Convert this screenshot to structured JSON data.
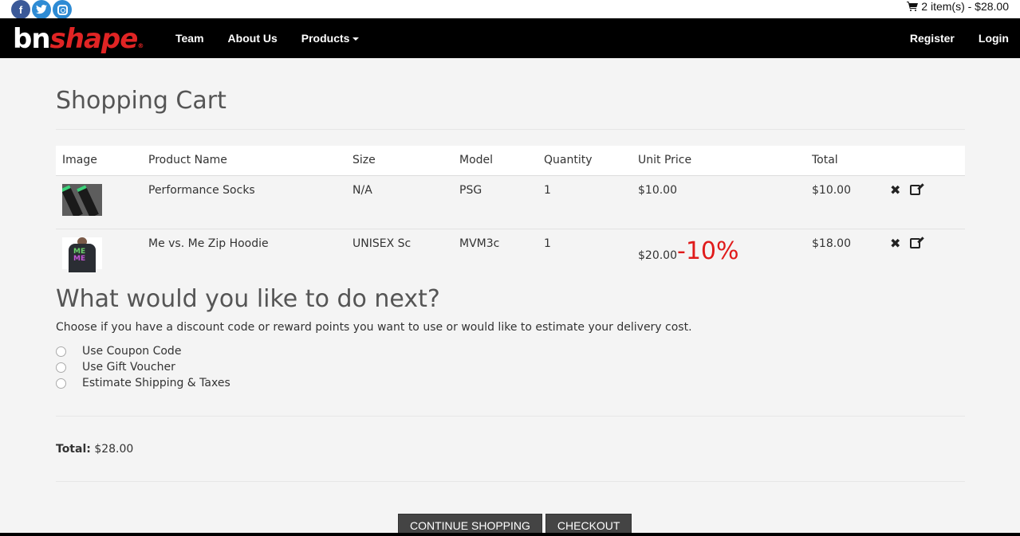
{
  "header": {
    "cart_summary": "2 item(s) - $28.00",
    "social": [
      "facebook-icon",
      "twitter-icon",
      "instagram-icon"
    ]
  },
  "nav": {
    "logo_bn": "bn",
    "logo_shape": "shape",
    "logo_reg": "®",
    "links": [
      "Team",
      "About Us",
      "Products"
    ],
    "right_links": [
      "Register",
      "Login"
    ]
  },
  "page": {
    "title": "Shopping Cart",
    "columns": [
      "Image",
      "Product Name",
      "Size",
      "Model",
      "Quantity",
      "Unit Price",
      "Total"
    ],
    "rows": [
      {
        "name": "Performance Socks",
        "size": "N/A",
        "model": "PSG",
        "quantity": "1",
        "unit_price": "$10.00",
        "total": "$10.00",
        "thumb": "socks"
      },
      {
        "name": "Me vs. Me Zip Hoodie",
        "size": "UNISEX Sc",
        "model": "MVM3c",
        "quantity": "1",
        "unit_price_old": "$20.00",
        "discount": "-10%",
        "total": "$18.00",
        "thumb": "hoodie"
      }
    ],
    "next_title": "What would you like to do next?",
    "next_desc": "Choose if you have a discount code or reward points you want to use or would like to estimate your delivery cost.",
    "options": [
      "Use Coupon Code",
      "Use Gift Voucher",
      "Estimate Shipping & Taxes"
    ],
    "total_label": "Total:",
    "total_value": "$28.00",
    "continue_label": "Continue Shopping",
    "checkout_label": "Checkout"
  },
  "colors": {
    "accent_red": "#e01b1b",
    "navbar": "#000000",
    "button": "#444444"
  }
}
